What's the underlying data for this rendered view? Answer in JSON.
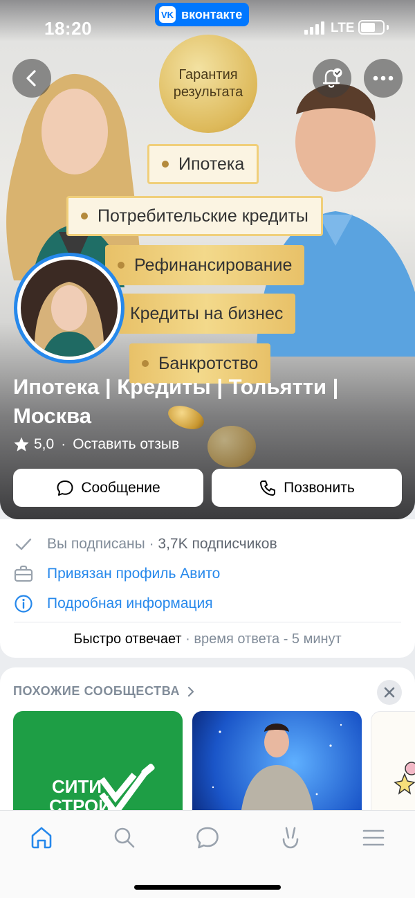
{
  "status_bar": {
    "time": "18:20",
    "app_pill": "вконтакте",
    "app_pill_logo": "VK",
    "network": "LTE"
  },
  "cover": {
    "seal_text": "Гарантия результата",
    "tags": [
      "Ипотека",
      "Потребительские кредиты",
      "Рефинансирование",
      "Кредиты на бизнес",
      "Банкротство"
    ]
  },
  "community": {
    "title": "Ипотека | Кредиты | Тольятти | Москва",
    "rating": "5,0",
    "rating_separator": "·",
    "review_link": "Оставить отзыв"
  },
  "actions": {
    "message_label": "Сообщение",
    "call_label": "Позвонить"
  },
  "info": {
    "subscribed": "Вы подписаны",
    "separator": " · ",
    "subscribers": "3,7K подписчиков",
    "avito": "Привязан профиль Авито",
    "details": "Подробная информация",
    "fast_reply": "Быстро отвечает",
    "reply_time": " · время ответа - 5 минут"
  },
  "similar": {
    "title": "ПОХОЖИЕ СООБЩЕСТВА",
    "cards": [
      {
        "logo_text_1": "СИТИ",
        "logo_text_2": "СТРОЙ"
      }
    ]
  },
  "colors": {
    "accent": "#2688eb",
    "vk_blue": "#0077ff",
    "muted": "#818c99"
  }
}
